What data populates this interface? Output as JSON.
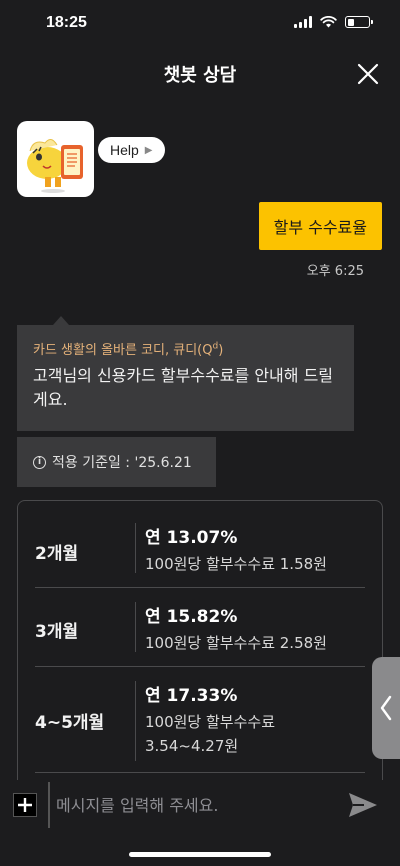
{
  "status": {
    "time": "18:25"
  },
  "header": {
    "title": "챗봇 상담"
  },
  "help_chip": {
    "label": "Help"
  },
  "user_message": {
    "text": "할부 수수료율",
    "time": "오후 6:25"
  },
  "bot_message": {
    "sub_prefix": "카드 생활의 올바른 코디, 큐디(Q",
    "sub_sup": "d",
    "sub_suffix": ")",
    "text": "고객님의 신용카드 할부수수료를 안내해 드릴게요."
  },
  "date_info": {
    "icon_label": "i",
    "text": "적용 기준일 : '25.6.21"
  },
  "rates": [
    {
      "months": "2개월",
      "rate": "연 13.07%",
      "detail": "100원당 할부수수료 1.58원"
    },
    {
      "months": "3개월",
      "rate": "연 15.82%",
      "detail": "100원당 할부수수료 2.58원"
    },
    {
      "months": "4~5개월",
      "rate": "연 17.33%",
      "detail": "100원당 할부수수료 3.54~4.27원"
    }
  ],
  "input": {
    "placeholder": "메시지를 입력해 주세요."
  },
  "colors": {
    "accent": "#fcc200",
    "background": "#1c1c1e",
    "bubble": "#3a3a3c",
    "subtitle": "#e5b27a"
  }
}
